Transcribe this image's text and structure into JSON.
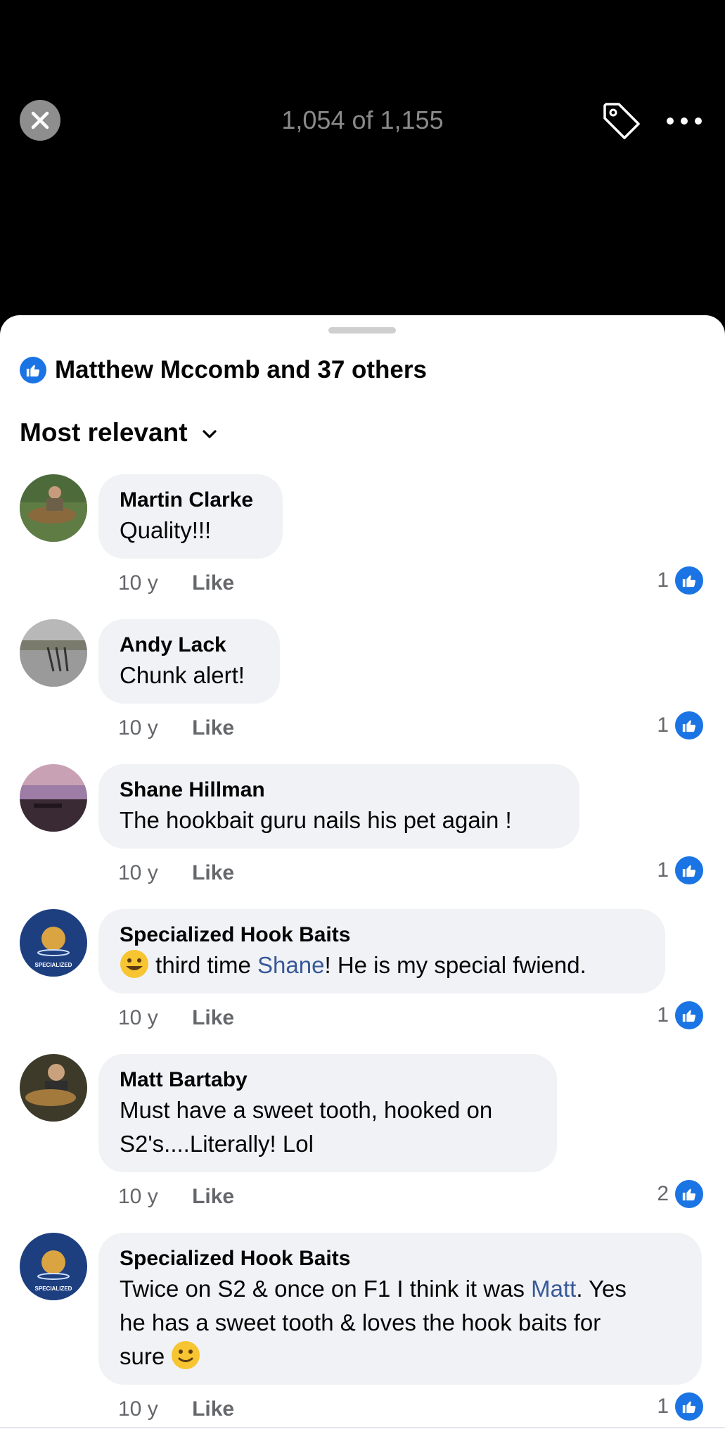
{
  "header": {
    "counter": "1,054 of 1,155"
  },
  "reactions": {
    "summary": "Matthew Mccomb and 37 others"
  },
  "sort": {
    "label": "Most relevant"
  },
  "comments": [
    {
      "author": "Martin Clarke",
      "text_parts": [
        "Quality!!!"
      ],
      "time": "10 y",
      "like_label": "Like",
      "like_count": "1"
    },
    {
      "author": "Andy Lack",
      "text_parts": [
        "Chunk alert!"
      ],
      "time": "10 y",
      "like_label": "Like",
      "like_count": "1"
    },
    {
      "author": "Shane Hillman",
      "text_parts": [
        "The hookbait guru nails his pet again !"
      ],
      "time": "10 y",
      "like_label": "Like",
      "like_count": "1"
    },
    {
      "author": "Specialized Hook Baits",
      "text_parts": [
        "third time ",
        "Shane",
        "! He is my special fwiend."
      ],
      "time": "10 y",
      "like_label": "Like",
      "like_count": "1"
    },
    {
      "author": "Matt Bartaby",
      "text_parts": [
        "Must have a sweet tooth, hooked on",
        "S2's....Literally! Lol"
      ],
      "time": "10 y",
      "like_label": "Like",
      "like_count": "2"
    },
    {
      "author": "Specialized Hook Baits",
      "text_parts": [
        "Twice on S2 & once on F1 I think it was ",
        "Matt",
        ". Yes",
        "he has a sweet tooth & loves the hook baits for",
        "sure"
      ],
      "time": "10 y",
      "like_label": "Like",
      "like_count": "1"
    }
  ],
  "avatar_logo_text": "SPECIALIZED HOOK BAITS",
  "colors": {
    "accent": "#1b74e4",
    "link": "#385898",
    "bubble": "#f0f2f5",
    "meta": "#65676b"
  }
}
